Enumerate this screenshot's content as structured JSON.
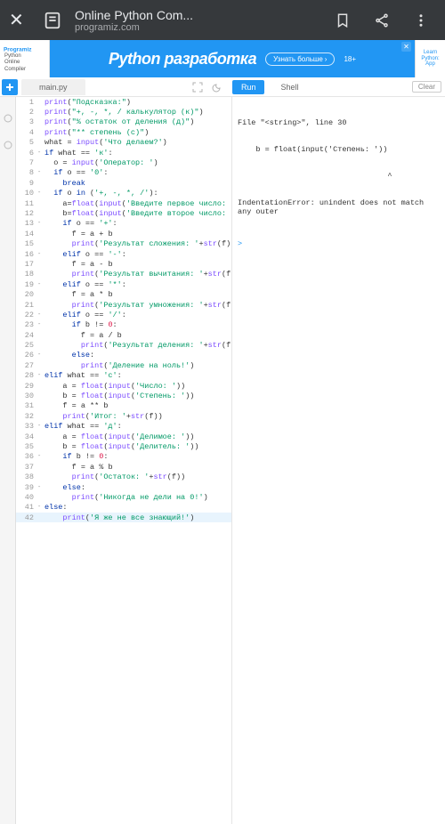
{
  "browser": {
    "title": "Online Python Com...",
    "subtitle": "programiz.com"
  },
  "logo": {
    "name": "Programiz",
    "lines": [
      "Python",
      "Online",
      "Compiler"
    ]
  },
  "ad": {
    "text": "Python разработка",
    "cta": "Узнать больше",
    "age": "18+"
  },
  "side_ad": {
    "l1": "Learn",
    "l2": "Python:",
    "l3": "App"
  },
  "toolbar": {
    "tab": "main.py",
    "run": "Run",
    "shell": "Shell",
    "clear": "Clear"
  },
  "lines": [
    {
      "n": 1,
      "fold": "",
      "code": [
        [
          "fn",
          "print"
        ],
        [
          "op",
          "("
        ],
        [
          "st",
          "\"Подсказка:\""
        ],
        [
          "op",
          ")"
        ]
      ]
    },
    {
      "n": 2,
      "fold": "",
      "code": [
        [
          "fn",
          "print"
        ],
        [
          "op",
          "("
        ],
        [
          "st",
          "\"+, -, *, / калькулятор (к)\""
        ],
        [
          "op",
          ")"
        ]
      ]
    },
    {
      "n": 3,
      "fold": "",
      "code": [
        [
          "fn",
          "print"
        ],
        [
          "op",
          "("
        ],
        [
          "st",
          "\"% остаток от деления (д)\""
        ],
        [
          "op",
          ")"
        ]
      ]
    },
    {
      "n": 4,
      "fold": "",
      "code": [
        [
          "fn",
          "print"
        ],
        [
          "op",
          "("
        ],
        [
          "st",
          "\"** степень (с)\""
        ],
        [
          "op",
          ")"
        ]
      ]
    },
    {
      "n": 5,
      "fold": "",
      "code": [
        [
          "id",
          "what "
        ],
        [
          "op",
          "="
        ],
        [
          "id",
          " "
        ],
        [
          "fn",
          "input"
        ],
        [
          "op",
          "("
        ],
        [
          "st",
          "'Что делаем?'"
        ],
        [
          "op",
          ")"
        ]
      ]
    },
    {
      "n": 6,
      "fold": "-",
      "code": [
        [
          "kw",
          "if"
        ],
        [
          "id",
          " what "
        ],
        [
          "op",
          "=="
        ],
        [
          "id",
          " "
        ],
        [
          "st",
          "'к'"
        ],
        [
          "op",
          ":"
        ]
      ]
    },
    {
      "n": 7,
      "fold": "",
      "code": [
        [
          "id",
          "  o "
        ],
        [
          "op",
          "="
        ],
        [
          "id",
          " "
        ],
        [
          "fn",
          "input"
        ],
        [
          "op",
          "("
        ],
        [
          "st",
          "'Оператор: '"
        ],
        [
          "op",
          ")"
        ]
      ]
    },
    {
      "n": 8,
      "fold": "-",
      "code": [
        [
          "id",
          "  "
        ],
        [
          "kw",
          "if"
        ],
        [
          "id",
          " o "
        ],
        [
          "op",
          "=="
        ],
        [
          "id",
          " "
        ],
        [
          "st",
          "'0'"
        ],
        [
          "op",
          ":"
        ]
      ]
    },
    {
      "n": 9,
      "fold": "",
      "code": [
        [
          "id",
          "    "
        ],
        [
          "kw",
          "break"
        ]
      ]
    },
    {
      "n": 10,
      "fold": "-",
      "code": [
        [
          "id",
          "  "
        ],
        [
          "kw",
          "if"
        ],
        [
          "id",
          " o "
        ],
        [
          "kw",
          "in"
        ],
        [
          "id",
          " "
        ],
        [
          "op",
          "("
        ],
        [
          "st",
          "'+, -, *, /'"
        ],
        [
          "op",
          "):"
        ]
      ]
    },
    {
      "n": 11,
      "fold": "",
      "code": [
        [
          "id",
          "    a"
        ],
        [
          "op",
          "="
        ],
        [
          "fn",
          "float"
        ],
        [
          "op",
          "("
        ],
        [
          "fn",
          "input"
        ],
        [
          "op",
          "("
        ],
        [
          "st",
          "'Введите первое число: '"
        ],
        [
          "op",
          "))"
        ]
      ]
    },
    {
      "n": 12,
      "fold": "",
      "code": [
        [
          "id",
          "    b"
        ],
        [
          "op",
          "="
        ],
        [
          "fn",
          "float"
        ],
        [
          "op",
          "("
        ],
        [
          "fn",
          "input"
        ],
        [
          "op",
          "("
        ],
        [
          "st",
          "'Введите второе число: '"
        ],
        [
          "op",
          "))"
        ]
      ]
    },
    {
      "n": 13,
      "fold": "-",
      "code": [
        [
          "id",
          "    "
        ],
        [
          "kw",
          "if"
        ],
        [
          "id",
          " o "
        ],
        [
          "op",
          "=="
        ],
        [
          "id",
          " "
        ],
        [
          "st",
          "'+'"
        ],
        [
          "op",
          ":"
        ]
      ]
    },
    {
      "n": 14,
      "fold": "",
      "code": [
        [
          "id",
          "      f "
        ],
        [
          "op",
          "="
        ],
        [
          "id",
          " a "
        ],
        [
          "op",
          "+"
        ],
        [
          "id",
          " b"
        ]
      ]
    },
    {
      "n": 15,
      "fold": "",
      "code": [
        [
          "id",
          "      "
        ],
        [
          "fn",
          "print"
        ],
        [
          "op",
          "("
        ],
        [
          "st",
          "'Результат сложения: '"
        ],
        [
          "op",
          "+"
        ],
        [
          "fn",
          "str"
        ],
        [
          "op",
          "("
        ],
        [
          "id",
          "f"
        ],
        [
          "op",
          "))"
        ]
      ]
    },
    {
      "n": 16,
      "fold": "-",
      "code": [
        [
          "id",
          "    "
        ],
        [
          "kw",
          "elif"
        ],
        [
          "id",
          " o "
        ],
        [
          "op",
          "=="
        ],
        [
          "id",
          " "
        ],
        [
          "st",
          "'-'"
        ],
        [
          "op",
          ":"
        ]
      ]
    },
    {
      "n": 17,
      "fold": "",
      "code": [
        [
          "id",
          "      f "
        ],
        [
          "op",
          "="
        ],
        [
          "id",
          " a "
        ],
        [
          "op",
          "-"
        ],
        [
          "id",
          " b"
        ]
      ]
    },
    {
      "n": 18,
      "fold": "",
      "code": [
        [
          "id",
          "      "
        ],
        [
          "fn",
          "print"
        ],
        [
          "op",
          "("
        ],
        [
          "st",
          "'Результат вычитания: '"
        ],
        [
          "op",
          "+"
        ],
        [
          "fn",
          "str"
        ],
        [
          "op",
          "("
        ],
        [
          "id",
          "f"
        ],
        [
          "op",
          "))"
        ]
      ]
    },
    {
      "n": 19,
      "fold": "-",
      "code": [
        [
          "id",
          "    "
        ],
        [
          "kw",
          "elif"
        ],
        [
          "id",
          " o "
        ],
        [
          "op",
          "=="
        ],
        [
          "id",
          " "
        ],
        [
          "st",
          "'*'"
        ],
        [
          "op",
          ":"
        ]
      ]
    },
    {
      "n": 20,
      "fold": "",
      "code": [
        [
          "id",
          "      f "
        ],
        [
          "op",
          "="
        ],
        [
          "id",
          " a "
        ],
        [
          "op",
          "*"
        ],
        [
          "id",
          " b"
        ]
      ]
    },
    {
      "n": 21,
      "fold": "",
      "code": [
        [
          "id",
          "      "
        ],
        [
          "fn",
          "print"
        ],
        [
          "op",
          "("
        ],
        [
          "st",
          "'Результат умножения: '"
        ],
        [
          "op",
          "+"
        ],
        [
          "fn",
          "str"
        ],
        [
          "op",
          "("
        ],
        [
          "id",
          "f"
        ],
        [
          "op",
          "))"
        ]
      ]
    },
    {
      "n": 22,
      "fold": "-",
      "code": [
        [
          "id",
          "    "
        ],
        [
          "kw",
          "elif"
        ],
        [
          "id",
          " o "
        ],
        [
          "op",
          "=="
        ],
        [
          "id",
          " "
        ],
        [
          "st",
          "'/'"
        ],
        [
          "op",
          ":"
        ]
      ]
    },
    {
      "n": 23,
      "fold": "-",
      "code": [
        [
          "id",
          "      "
        ],
        [
          "kw",
          "if"
        ],
        [
          "id",
          " b "
        ],
        [
          "op",
          "!="
        ],
        [
          "id",
          " "
        ],
        [
          "nm",
          "0"
        ],
        [
          "op",
          ":"
        ]
      ]
    },
    {
      "n": 24,
      "fold": "",
      "code": [
        [
          "id",
          "        f "
        ],
        [
          "op",
          "="
        ],
        [
          "id",
          " a "
        ],
        [
          "op",
          "/"
        ],
        [
          "id",
          " b"
        ]
      ]
    },
    {
      "n": 25,
      "fold": "",
      "code": [
        [
          "id",
          "        "
        ],
        [
          "fn",
          "print"
        ],
        [
          "op",
          "("
        ],
        [
          "st",
          "'Результат деления: '"
        ],
        [
          "op",
          "+"
        ],
        [
          "fn",
          "str"
        ],
        [
          "op",
          "("
        ],
        [
          "id",
          "f"
        ],
        [
          "op",
          "))"
        ]
      ]
    },
    {
      "n": 26,
      "fold": "-",
      "code": [
        [
          "id",
          "      "
        ],
        [
          "kw",
          "else"
        ],
        [
          "op",
          ":"
        ]
      ]
    },
    {
      "n": 27,
      "fold": "",
      "code": [
        [
          "id",
          "        "
        ],
        [
          "fn",
          "print"
        ],
        [
          "op",
          "("
        ],
        [
          "st",
          "'Деление на ноль!'"
        ],
        [
          "op",
          ")"
        ]
      ]
    },
    {
      "n": 28,
      "fold": "-",
      "code": [
        [
          "kw",
          "elif"
        ],
        [
          "id",
          " what "
        ],
        [
          "op",
          "=="
        ],
        [
          "id",
          " "
        ],
        [
          "st",
          "'с'"
        ],
        [
          "op",
          ":"
        ]
      ]
    },
    {
      "n": 29,
      "fold": "",
      "code": [
        [
          "id",
          "    a "
        ],
        [
          "op",
          "="
        ],
        [
          "id",
          " "
        ],
        [
          "fn",
          "float"
        ],
        [
          "op",
          "("
        ],
        [
          "fn",
          "input"
        ],
        [
          "op",
          "("
        ],
        [
          "st",
          "'Число: '"
        ],
        [
          "op",
          "))"
        ]
      ]
    },
    {
      "n": 30,
      "fold": "",
      "code": [
        [
          "id",
          "    b "
        ],
        [
          "op",
          "="
        ],
        [
          "id",
          " "
        ],
        [
          "fn",
          "float"
        ],
        [
          "op",
          "("
        ],
        [
          "fn",
          "input"
        ],
        [
          "op",
          "("
        ],
        [
          "st",
          "'Степень: '"
        ],
        [
          "op",
          "))"
        ]
      ]
    },
    {
      "n": 31,
      "fold": "",
      "code": [
        [
          "id",
          "    f "
        ],
        [
          "op",
          "="
        ],
        [
          "id",
          " a "
        ],
        [
          "op",
          "**"
        ],
        [
          "id",
          " b"
        ]
      ]
    },
    {
      "n": 32,
      "fold": "",
      "code": [
        [
          "id",
          "    "
        ],
        [
          "fn",
          "print"
        ],
        [
          "op",
          "("
        ],
        [
          "st",
          "'Итог: '"
        ],
        [
          "op",
          "+"
        ],
        [
          "fn",
          "str"
        ],
        [
          "op",
          "("
        ],
        [
          "id",
          "f"
        ],
        [
          "op",
          "))"
        ]
      ]
    },
    {
      "n": 33,
      "fold": "-",
      "code": [
        [
          "kw",
          "elif"
        ],
        [
          "id",
          " what "
        ],
        [
          "op",
          "=="
        ],
        [
          "id",
          " "
        ],
        [
          "st",
          "'д'"
        ],
        [
          "op",
          ":"
        ]
      ]
    },
    {
      "n": 34,
      "fold": "",
      "code": [
        [
          "id",
          "    a "
        ],
        [
          "op",
          "="
        ],
        [
          "id",
          " "
        ],
        [
          "fn",
          "float"
        ],
        [
          "op",
          "("
        ],
        [
          "fn",
          "input"
        ],
        [
          "op",
          "("
        ],
        [
          "st",
          "'Делимое: '"
        ],
        [
          "op",
          "))"
        ]
      ]
    },
    {
      "n": 35,
      "fold": "",
      "code": [
        [
          "id",
          "    b "
        ],
        [
          "op",
          "="
        ],
        [
          "id",
          " "
        ],
        [
          "fn",
          "float"
        ],
        [
          "op",
          "("
        ],
        [
          "fn",
          "input"
        ],
        [
          "op",
          "("
        ],
        [
          "st",
          "'Делитель: '"
        ],
        [
          "op",
          "))"
        ]
      ]
    },
    {
      "n": 36,
      "fold": "-",
      "code": [
        [
          "id",
          "    "
        ],
        [
          "kw",
          "if"
        ],
        [
          "id",
          " b "
        ],
        [
          "op",
          "!="
        ],
        [
          "id",
          " "
        ],
        [
          "nm",
          "0"
        ],
        [
          "op",
          ":"
        ]
      ]
    },
    {
      "n": 37,
      "fold": "",
      "code": [
        [
          "id",
          "      f "
        ],
        [
          "op",
          "="
        ],
        [
          "id",
          " a "
        ],
        [
          "op",
          "%"
        ],
        [
          "id",
          " b"
        ]
      ]
    },
    {
      "n": 38,
      "fold": "",
      "code": [
        [
          "id",
          "      "
        ],
        [
          "fn",
          "print"
        ],
        [
          "op",
          "("
        ],
        [
          "st",
          "'Остаток: '"
        ],
        [
          "op",
          "+"
        ],
        [
          "fn",
          "str"
        ],
        [
          "op",
          "("
        ],
        [
          "id",
          "f"
        ],
        [
          "op",
          "))"
        ]
      ]
    },
    {
      "n": 39,
      "fold": "-",
      "code": [
        [
          "id",
          "    "
        ],
        [
          "kw",
          "else"
        ],
        [
          "op",
          ":"
        ]
      ]
    },
    {
      "n": 40,
      "fold": "",
      "code": [
        [
          "id",
          "      "
        ],
        [
          "fn",
          "print"
        ],
        [
          "op",
          "("
        ],
        [
          "st",
          "'Никогда не дели на 0!'"
        ],
        [
          "op",
          ")"
        ]
      ]
    },
    {
      "n": 41,
      "fold": "-",
      "code": [
        [
          "kw",
          "else"
        ],
        [
          "op",
          ":"
        ]
      ]
    },
    {
      "n": 42,
      "fold": "",
      "hl": true,
      "code": [
        [
          "id",
          "    "
        ],
        [
          "fn",
          "print"
        ],
        [
          "op",
          "("
        ],
        [
          "st",
          "'Я же не все знающий!'"
        ],
        [
          "op",
          ")"
        ]
      ]
    }
  ],
  "shell_out": {
    "l1": "File \"<string>\", line 30",
    "l2": "    b = float(input('Степень: '))",
    "l3": "                                 ^",
    "l4": "IndentationError: unindent does not match any outer"
  }
}
